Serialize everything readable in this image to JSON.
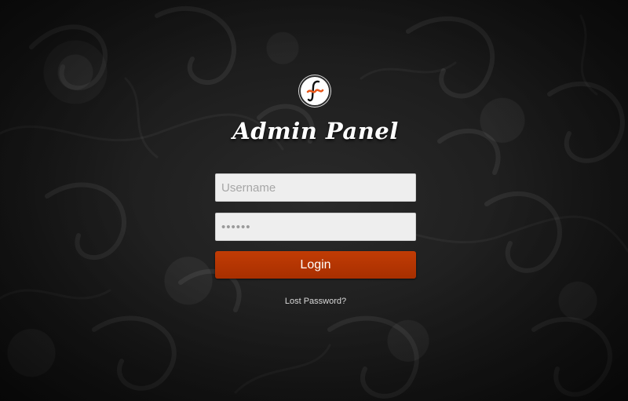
{
  "app": {
    "title": "Admin Panel"
  },
  "logo": {
    "icon": "f-logo-icon",
    "accent_color": "#e8581c"
  },
  "form": {
    "username": {
      "placeholder": "Username",
      "value": ""
    },
    "password": {
      "value": "••••••"
    },
    "login_label": "Login",
    "login_color": "#b53400",
    "lost_password_label": "Lost Password?"
  }
}
